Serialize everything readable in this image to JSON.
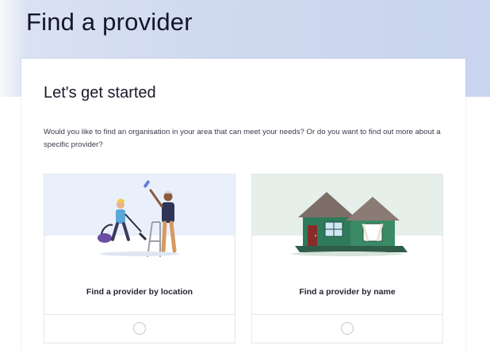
{
  "header": {
    "title": "Find a provider"
  },
  "panel": {
    "heading": "Let's get started",
    "intro": "Would you like to find an organisation in your area that can meet your needs? Or do you want to find out more about a specific provider?"
  },
  "options": [
    {
      "label": "Find a provider by location",
      "illustration": "people-cleaning-illustration",
      "selected": false
    },
    {
      "label": "Find a provider by name",
      "illustration": "house-illustration",
      "selected": false
    }
  ],
  "colors": {
    "hero_background": "#cfd9ef",
    "location_card_background": "#e9f0fb",
    "name_card_background": "#e6efe9",
    "house_wall": "#2f7a5a",
    "roof": "#7d6e68"
  }
}
